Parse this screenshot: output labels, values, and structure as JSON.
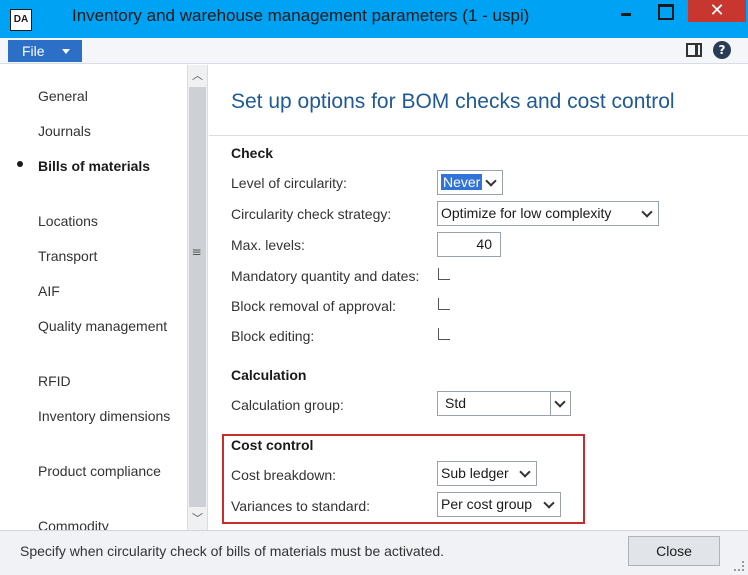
{
  "window": {
    "title": "Inventory and warehouse management parameters (1 - uspi)",
    "app_icon_text": "DA",
    "close_glyph": "✕"
  },
  "menubar": {
    "file_label": "File"
  },
  "nav": {
    "items": [
      {
        "label": "General"
      },
      {
        "label": "Journals"
      },
      {
        "label": "Bills of materials",
        "active": true
      },
      {
        "label": "Locations"
      },
      {
        "label": "Transport"
      },
      {
        "label": "AIF"
      },
      {
        "label": "Quality management"
      },
      {
        "label": "RFID"
      },
      {
        "label": "Inventory dimensions"
      },
      {
        "label": "Product compliance"
      },
      {
        "label": "Commodity"
      }
    ]
  },
  "content": {
    "title": "Set up options for BOM checks and cost control",
    "check": {
      "heading": "Check",
      "level_of_circularity": {
        "label": "Level of circularity:",
        "value": "Never"
      },
      "circularity_check_strategy": {
        "label": "Circularity check strategy:",
        "value": "Optimize for low complexity"
      },
      "max_levels": {
        "label": "Max. levels:",
        "value": "40"
      },
      "mandatory_quantity_dates": {
        "label": "Mandatory quantity and dates:",
        "checked": false
      },
      "block_removal_of_approval": {
        "label": "Block removal of approval:",
        "checked": false
      },
      "block_editing": {
        "label": "Block editing:",
        "checked": false
      }
    },
    "calculation": {
      "heading": "Calculation",
      "calculation_group": {
        "label": "Calculation group:",
        "value": "Std"
      }
    },
    "cost_control": {
      "heading": "Cost control",
      "cost_breakdown": {
        "label": "Cost breakdown:",
        "value": "Sub ledger"
      },
      "variances_to_standard": {
        "label": "Variances to standard:",
        "value": "Per cost group"
      }
    }
  },
  "status": {
    "text": "Specify when circularity check of bills of materials must be activated.",
    "close_label": "Close"
  },
  "colors": {
    "titlebar": "#00a2f3",
    "file_button": "#2b6fc6",
    "heading_blue": "#1f5a96",
    "highlight_red": "#cc2b2b",
    "close_red": "#c7372f",
    "selection": "#3173d6"
  }
}
